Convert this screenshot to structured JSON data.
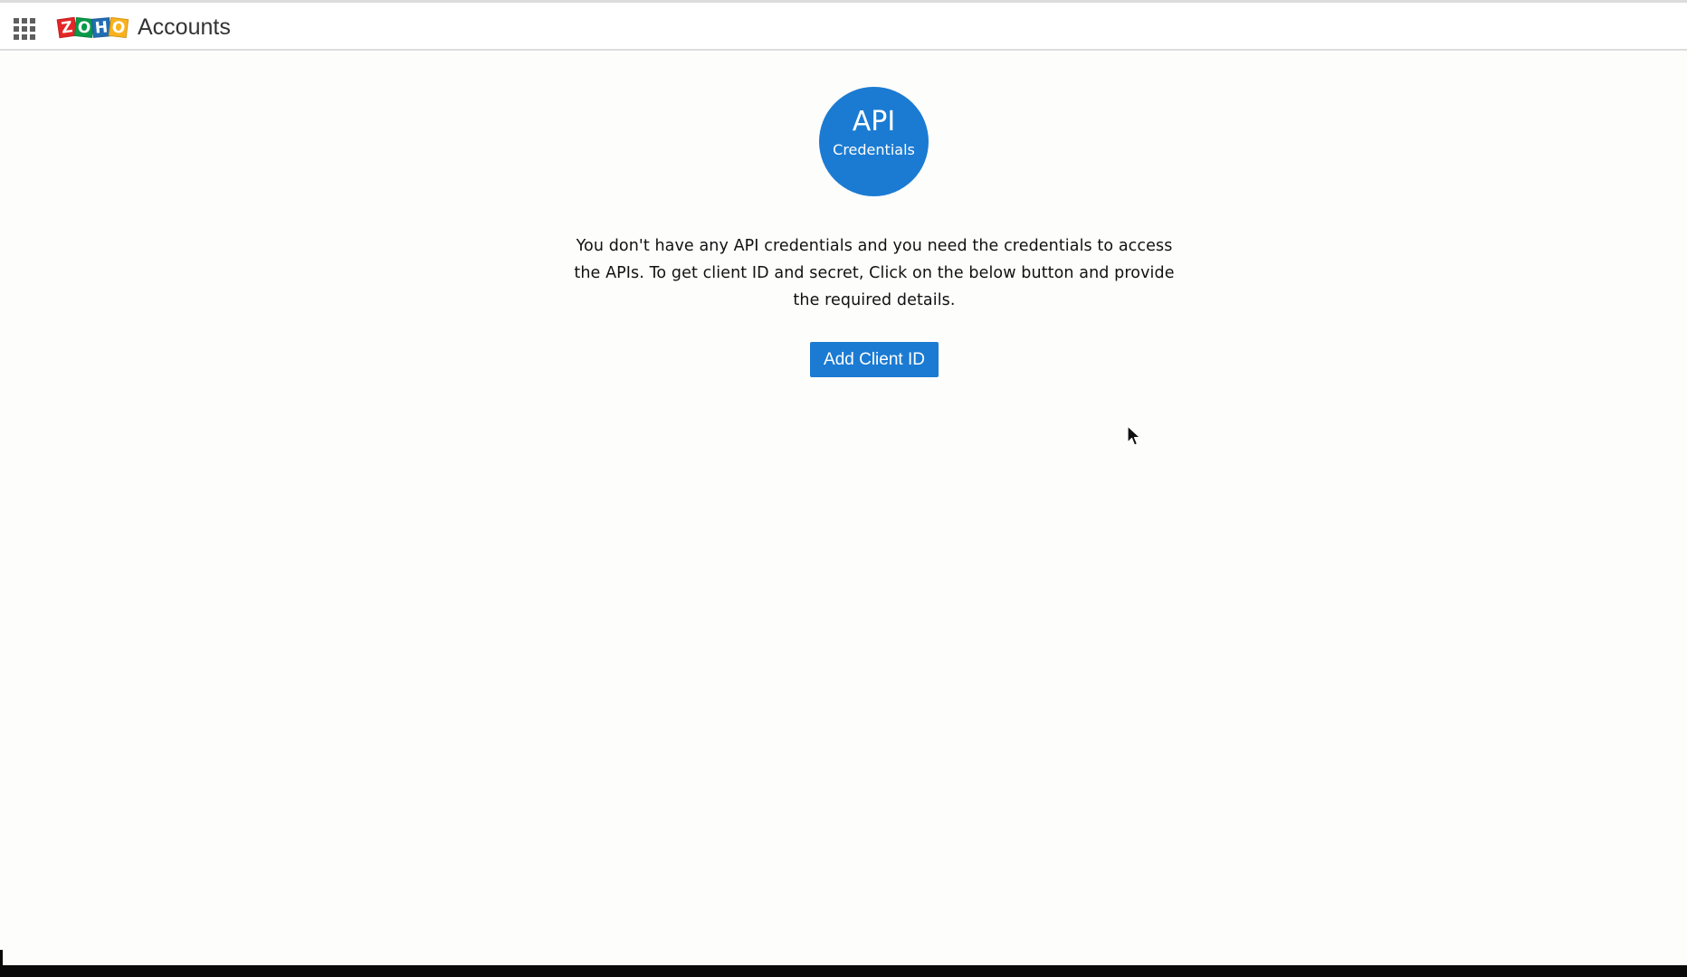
{
  "header": {
    "app_name": "Accounts",
    "logo_letters": [
      "Z",
      "O",
      "H",
      "O"
    ],
    "icons": {
      "apps": "apps-grid-icon"
    }
  },
  "main": {
    "badge": {
      "title": "API",
      "subtitle": "Credentials"
    },
    "message": "You don't have any API credentials and you need the credentials to access the APIs. To get client ID and secret, Click on the below button and provide the required details.",
    "add_button_label": "Add Client ID"
  },
  "colors": {
    "accent": "#1b7bd2",
    "zoho_red": "#e42527",
    "zoho_green": "#089949",
    "zoho_blue": "#226db4",
    "zoho_yellow": "#f9b21d"
  }
}
